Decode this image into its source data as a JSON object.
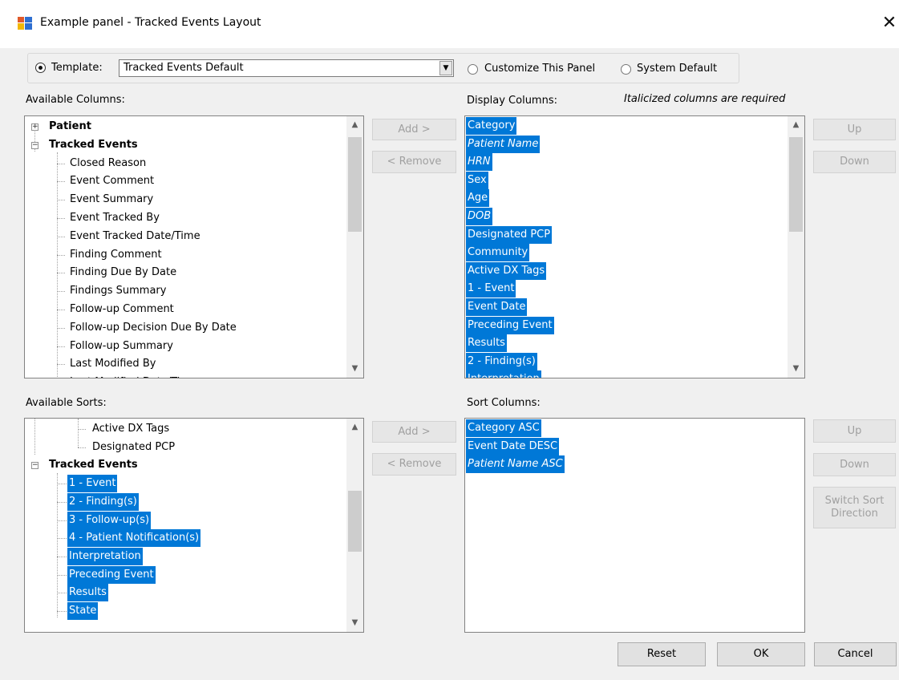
{
  "window": {
    "title": "Example panel - Tracked Events Layout",
    "close_glyph": "✕"
  },
  "template": {
    "radio_template_label": "Template:",
    "selected": "Tracked Events Default",
    "radio_customize_label": "Customize This Panel",
    "radio_system_label": "System Default"
  },
  "available_columns": {
    "label": "Available Columns:",
    "items": [
      {
        "text": "Patient",
        "type": "group",
        "expander": "+"
      },
      {
        "text": "Tracked Events",
        "type": "group",
        "expander": "−"
      },
      {
        "text": "Closed Reason"
      },
      {
        "text": "Event Comment"
      },
      {
        "text": "Event Summary"
      },
      {
        "text": "Event Tracked By"
      },
      {
        "text": "Event Tracked Date/Time"
      },
      {
        "text": "Finding Comment"
      },
      {
        "text": "Finding Due By Date"
      },
      {
        "text": "Findings Summary"
      },
      {
        "text": "Follow-up Comment"
      },
      {
        "text": "Follow-up Decision Due By Date"
      },
      {
        "text": "Follow-up Summary"
      },
      {
        "text": "Last Modified By"
      },
      {
        "text": "Last Modified Date/Time"
      }
    ]
  },
  "columns_buttons": {
    "add": "Add >",
    "remove": "< Remove"
  },
  "display_columns": {
    "label": "Display Columns:",
    "note": "Italicized columns are required",
    "items": [
      {
        "text": "Category",
        "italic": false
      },
      {
        "text": "Patient Name",
        "italic": true
      },
      {
        "text": "HRN",
        "italic": true
      },
      {
        "text": "Sex",
        "italic": false
      },
      {
        "text": "Age",
        "italic": false
      },
      {
        "text": "DOB",
        "italic": true
      },
      {
        "text": "Designated PCP",
        "italic": false
      },
      {
        "text": "Community",
        "italic": false
      },
      {
        "text": "Active DX Tags",
        "italic": false
      },
      {
        "text": "1 - Event",
        "italic": false
      },
      {
        "text": "Event Date",
        "italic": false
      },
      {
        "text": "Preceding Event",
        "italic": false
      },
      {
        "text": "Results",
        "italic": false
      },
      {
        "text": "2 - Finding(s)",
        "italic": false
      },
      {
        "text": "Interpretation",
        "italic": false
      }
    ],
    "up": "Up",
    "down": "Down"
  },
  "available_sorts": {
    "label": "Available Sorts:",
    "items": [
      {
        "text": "Active DX Tags",
        "selected": false
      },
      {
        "text": "Designated PCP",
        "selected": false
      },
      {
        "text": "Tracked Events",
        "group": true,
        "expander": "−"
      },
      {
        "text": "1 - Event",
        "selected": true
      },
      {
        "text": "2 - Finding(s)",
        "selected": true
      },
      {
        "text": "3 - Follow-up(s)",
        "selected": true
      },
      {
        "text": "4 - Patient Notification(s)",
        "selected": true
      },
      {
        "text": "Interpretation",
        "selected": true
      },
      {
        "text": "Preceding Event",
        "selected": true
      },
      {
        "text": "Results",
        "selected": true
      },
      {
        "text": "State",
        "selected": true
      }
    ]
  },
  "sorts_buttons": {
    "add": "Add >",
    "remove": "< Remove"
  },
  "sort_columns": {
    "label": "Sort Columns:",
    "items": [
      {
        "text": "Category ASC",
        "italic": false
      },
      {
        "text": "Event Date DESC",
        "italic": false
      },
      {
        "text": "Patient Name ASC",
        "italic": true
      }
    ],
    "up": "Up",
    "down": "Down",
    "switch_line1": "Switch Sort",
    "switch_line2": "Direction"
  },
  "footer": {
    "reset": "Reset",
    "ok": "OK",
    "cancel": "Cancel"
  },
  "colors": {
    "selection": "#0078d7",
    "window_bg": "#f0f0f0"
  }
}
